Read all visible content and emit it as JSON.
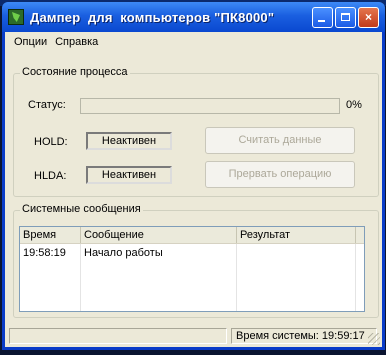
{
  "window": {
    "title": "Дампер  для  компьютеров \"ПК8000\"",
    "buttons": {
      "minimize": "minimize",
      "maximize": "maximize",
      "close": "×"
    }
  },
  "menu": {
    "items": [
      "Опции",
      "Справка"
    ]
  },
  "process_group": {
    "title": "Состояние процесса",
    "status_label": "Статус:",
    "progress_percent": 0,
    "progress_text": "0%",
    "hold_label": "HOLD:",
    "hold_value": "Неактивен",
    "hlda_label": "HLDA:",
    "hlda_value": "Неактивен",
    "read_button": "Считать данные",
    "abort_button": "Прервать операцию"
  },
  "messages_group": {
    "title": "Системные сообщения",
    "columns": [
      "Время",
      "Сообщение",
      "Результат"
    ],
    "rows": [
      {
        "time": "19:58:19",
        "message": "Начало работы",
        "result": ""
      }
    ]
  },
  "statusbar": {
    "left": "",
    "system_time": "Время системы: 19:59:17"
  },
  "colors": {
    "titlebar": "#1a5fe0",
    "client": "#ece9d8",
    "disabled_text": "#aca899"
  }
}
